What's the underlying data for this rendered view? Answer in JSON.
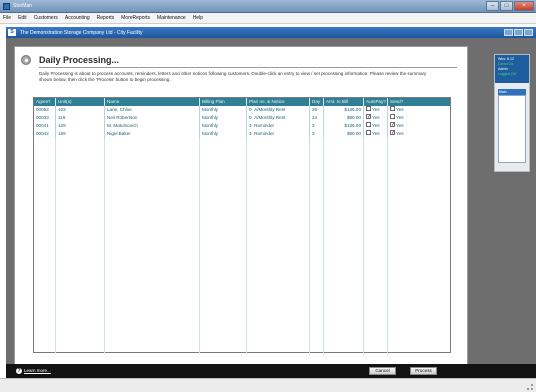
{
  "app": {
    "title": "StorMan"
  },
  "menu": [
    "File",
    "Edit",
    "Customers",
    "Accounting",
    "Reports",
    "MoreReports",
    "Maintenance",
    "Help"
  ],
  "doc": {
    "title": "The Demonstration Storage Company Ltd - City Facility"
  },
  "page": {
    "title": "Daily Processing...",
    "intro": "Daily Processing is about to process accounts, reminders, letters and other notices following customers. Double-click an entry to view / set processing information. Please review the summary shown below, then click the 'Process' button to begin processing."
  },
  "table": {
    "columns": [
      "Agree't",
      "Unit(s)",
      "Name",
      "Billing Plan",
      "Plan no. & Notice",
      "Day",
      "Amt. to Bill",
      "AutoPay?",
      "Send?"
    ],
    "rows": [
      {
        "agreement": "00052",
        "units": "103",
        "name": "Lane, Chloe",
        "billing_plan": "Monthly",
        "plan_no": "0",
        "notice": "A/Monthly Rent",
        "day": "26",
        "amount": "$135.00",
        "autopay_checked": false,
        "autopay_label": "Yes",
        "send_checked": false,
        "send_label": "Yes"
      },
      {
        "agreement": "00033",
        "units": "116",
        "name": "Neil Robertson",
        "billing_plan": "Monthly",
        "plan_no": "0",
        "notice": "A/Monthly Rent",
        "day": "24",
        "amount": "$90.00",
        "autopay_checked": true,
        "autopay_label": "Yes",
        "send_checked": false,
        "send_label": "Yes"
      },
      {
        "agreement": "00041",
        "units": "128",
        "name": "M. Matulnovich",
        "billing_plan": "Monthly",
        "plan_no": "3",
        "notice": "Reminder",
        "day": "3",
        "amount": "$135.00",
        "autopay_checked": false,
        "autopay_label": "Yes",
        "send_checked": true,
        "send_label": "Yes"
      },
      {
        "agreement": "00042",
        "units": "169",
        "name": "Nigel Baker",
        "billing_plan": "Monthly",
        "plan_no": "3",
        "notice": "Reminder",
        "day": "3",
        "amount": "$90.00",
        "autopay_checked": false,
        "autopay_label": "Yes",
        "send_checked": true,
        "send_label": "Yes"
      }
    ]
  },
  "side_widget": {
    "line1": "Wks: 8.12",
    "line2": "Demo Co",
    "line3": "Admin",
    "line4": "Logged Off",
    "selected": "Main"
  },
  "footer": {
    "help_label": "Learn more...",
    "cancel_label": "Cancel",
    "process_label": "Process"
  }
}
